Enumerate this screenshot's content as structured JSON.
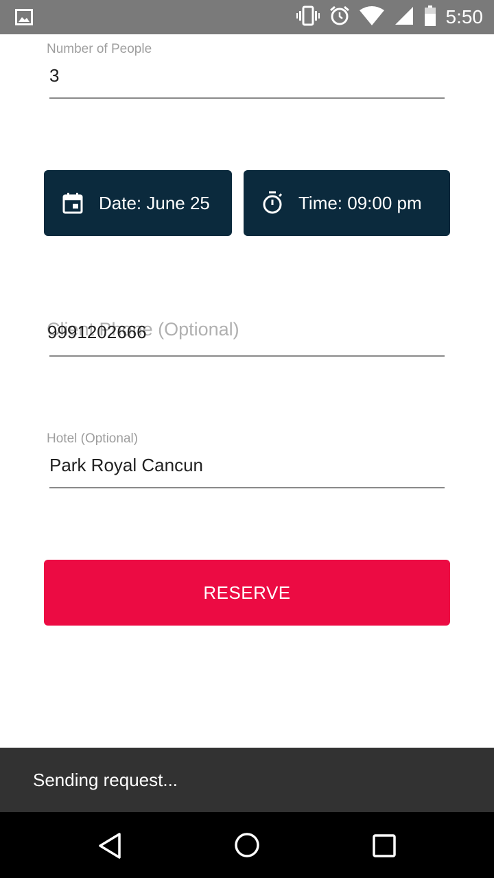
{
  "status_bar": {
    "time": "5:50",
    "icons": [
      "image-icon",
      "vibrate-icon",
      "alarm-icon",
      "wifi-icon",
      "signal-icon",
      "battery-icon"
    ]
  },
  "form": {
    "people": {
      "label": "Number of People",
      "value": "3"
    },
    "date_button": {
      "label": "Date: June 25",
      "icon": "calendar-icon"
    },
    "time_button": {
      "label": "Time: 09:00 pm",
      "icon": "timer-icon"
    },
    "phone": {
      "label": "Client Phone (Optional)",
      "value": "9991202666"
    },
    "hotel": {
      "label": "Hotel (Optional)",
      "value": "Park Royal Cancun"
    },
    "reserve_label": "RESERVE"
  },
  "snackbar": {
    "message": "Sending request..."
  },
  "nav": {
    "icons": [
      "back-icon",
      "home-icon",
      "recents-icon"
    ]
  },
  "colors": {
    "status_bar": "#7a7a7a",
    "picker_button": "#0b2a3d",
    "reserve_button": "#ec0b43",
    "snackbar": "#323232",
    "nav_bar": "#000000"
  }
}
